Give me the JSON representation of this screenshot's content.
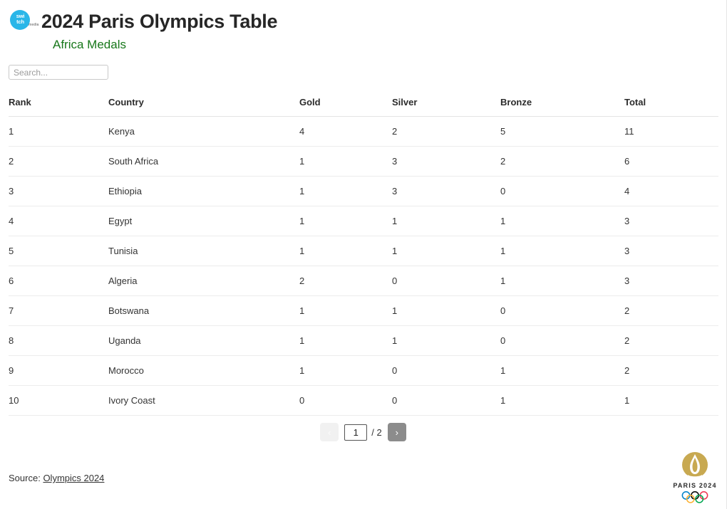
{
  "brand": {
    "logo_name": "switch-media-logo",
    "logo_text": "swi tch",
    "logo_sub": "media",
    "logo_color": "#29b6e8"
  },
  "header": {
    "title": "2024 Paris Olympics Table",
    "subtitle": "Africa Medals",
    "subtitle_color": "#17771a"
  },
  "search": {
    "placeholder": "Search...",
    "value": ""
  },
  "table": {
    "columns": [
      "Rank",
      "Country",
      "Gold",
      "Silver",
      "Bronze",
      "Total"
    ],
    "rows": [
      {
        "rank": "1",
        "country": "Kenya",
        "gold": "4",
        "silver": "2",
        "bronze": "5",
        "total": "11"
      },
      {
        "rank": "2",
        "country": "South Africa",
        "gold": "1",
        "silver": "3",
        "bronze": "2",
        "total": "6"
      },
      {
        "rank": "3",
        "country": "Ethiopia",
        "gold": "1",
        "silver": "3",
        "bronze": "0",
        "total": "4"
      },
      {
        "rank": "4",
        "country": "Egypt",
        "gold": "1",
        "silver": "1",
        "bronze": "1",
        "total": "3"
      },
      {
        "rank": "5",
        "country": "Tunisia",
        "gold": "1",
        "silver": "1",
        "bronze": "1",
        "total": "3"
      },
      {
        "rank": "6",
        "country": "Algeria",
        "gold": "2",
        "silver": "0",
        "bronze": "1",
        "total": "3"
      },
      {
        "rank": "7",
        "country": "Botswana",
        "gold": "1",
        "silver": "1",
        "bronze": "0",
        "total": "2"
      },
      {
        "rank": "8",
        "country": "Uganda",
        "gold": "1",
        "silver": "1",
        "bronze": "0",
        "total": "2"
      },
      {
        "rank": "9",
        "country": "Morocco",
        "gold": "1",
        "silver": "0",
        "bronze": "1",
        "total": "2"
      },
      {
        "rank": "10",
        "country": "Ivory Coast",
        "gold": "0",
        "silver": "0",
        "bronze": "1",
        "total": "1"
      }
    ]
  },
  "pagination": {
    "prev_label": "‹",
    "next_label": "›",
    "current_page": "1",
    "total_label": "/ 2",
    "prev_enabled": false,
    "next_enabled": true
  },
  "footer": {
    "source_label": "Source:",
    "source_link": "Olympics 2024"
  },
  "paris_logo": {
    "wordmark": "PARIS 2024",
    "emblem_color": "#c8a951",
    "rings": [
      "#0081c8",
      "#000000",
      "#ee334e",
      "#fcb131",
      "#00a651"
    ]
  }
}
